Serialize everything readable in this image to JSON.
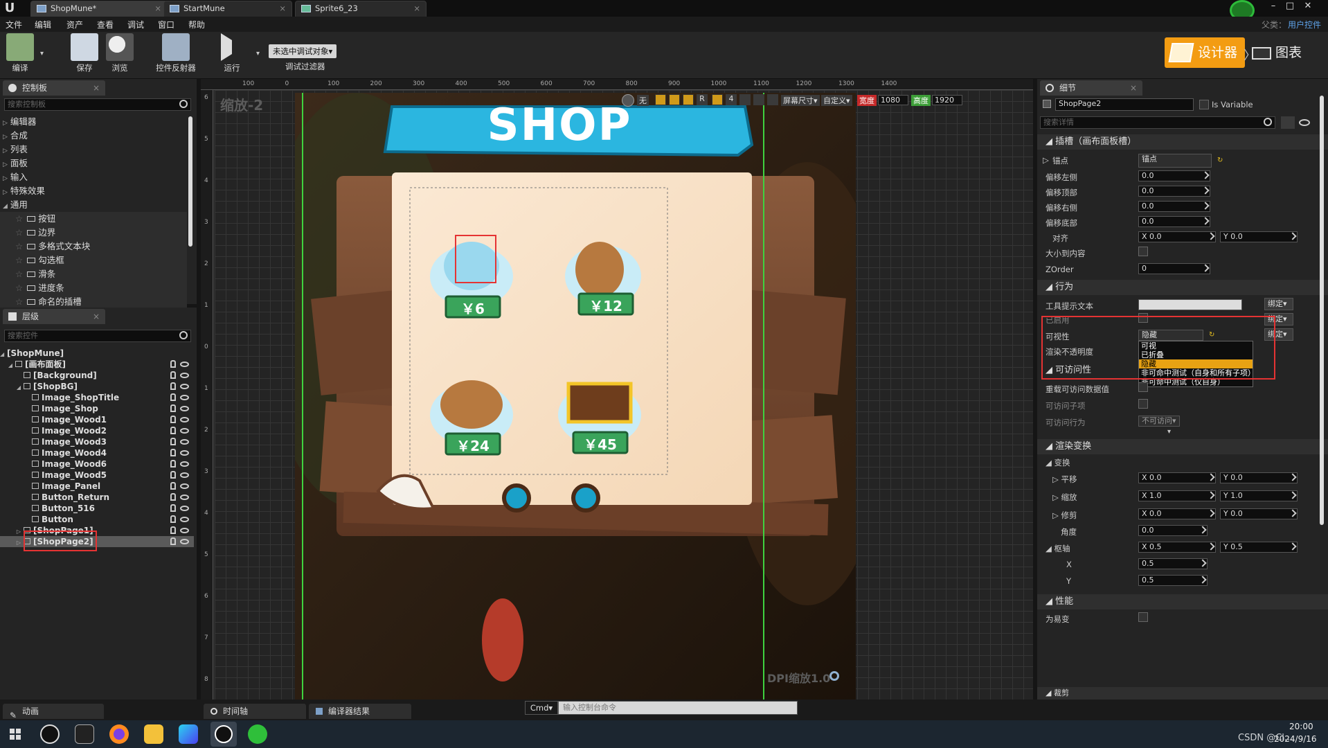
{
  "tabs": [
    {
      "label": "ShopMune*",
      "active": true
    },
    {
      "label": "StartMune",
      "active": false
    },
    {
      "label": "Sprite6_23",
      "active": false
    }
  ],
  "menu": [
    "文件",
    "编辑",
    "资产",
    "查看",
    "调试",
    "窗口",
    "帮助"
  ],
  "context": {
    "label": "父类：",
    "value": "用户控件"
  },
  "toolbar": {
    "compile": "编译",
    "save": "保存",
    "browse": "浏览",
    "reflector": "控件反射器",
    "run": "运行",
    "debug_select": "未选中调试对象▾",
    "debug_filter": "调试过滤器",
    "designer": "设计器",
    "graph": "图表"
  },
  "palette": {
    "title": "控制板",
    "search_placeholder": "搜索控制板",
    "categories": [
      "编辑器",
      "合成",
      "列表",
      "面板",
      "输入",
      "特殊效果",
      "通用"
    ],
    "items": [
      "按钮",
      "边界",
      "多格式文本块",
      "勾选框",
      "滑条",
      "进度条",
      "命名的插槽"
    ]
  },
  "hierarchy": {
    "title": "层级",
    "search_placeholder": "搜索控件",
    "rows": [
      {
        "label": "[ShopMune]",
        "indent": 0
      },
      {
        "label": "[画布面板]",
        "indent": 1
      },
      {
        "label": "[Background]",
        "indent": 2
      },
      {
        "label": "[ShopBG]",
        "indent": 2
      },
      {
        "label": "Image_ShopTitle",
        "indent": 3
      },
      {
        "label": "Image_Shop",
        "indent": 3
      },
      {
        "label": "Image_Wood1",
        "indent": 3
      },
      {
        "label": "Image_Wood2",
        "indent": 3
      },
      {
        "label": "Image_Wood3",
        "indent": 3
      },
      {
        "label": "Image_Wood4",
        "indent": 3
      },
      {
        "label": "Image_Wood6",
        "indent": 3
      },
      {
        "label": "Image_Wood5",
        "indent": 3
      },
      {
        "label": "Image_Panel",
        "indent": 3
      },
      {
        "label": "Button_Return",
        "indent": 3
      },
      {
        "label": "Button_516",
        "indent": 3
      },
      {
        "label": "Button",
        "indent": 3
      },
      {
        "label": "[ShopPage1]",
        "indent": 2
      },
      {
        "label": "[ShopPage2]",
        "indent": 2
      }
    ]
  },
  "canvas": {
    "zoom": "缩放-2",
    "dpi": "DPI缩放1.0",
    "ruler_top": [
      "100",
      "0",
      "100",
      "200",
      "300",
      "400",
      "500",
      "600",
      "700",
      "800",
      "900",
      "1000",
      "1100",
      "1200",
      "1300",
      "1400"
    ],
    "ruler_left": [
      "6",
      "5",
      "4",
      "3",
      "2",
      "1",
      "0",
      "1",
      "2",
      "3",
      "4",
      "5",
      "6",
      "7",
      "8"
    ],
    "topbar": {
      "none": "无",
      "screen": "屏幕尺寸▾",
      "custom": "自定义▾",
      "width_label": "宽度",
      "width": "1080",
      "height_label": "高度",
      "height": "1920",
      "r": "R",
      "four": "4"
    },
    "shop_title": "SHOP",
    "prices": [
      "￥6",
      "￥12",
      "￥24",
      "￥45"
    ]
  },
  "details": {
    "title": "细节",
    "name": "ShopPage2",
    "is_variable": "Is Variable",
    "search_placeholder": "搜索详情",
    "slot_section": "插槽（画布面板槽）",
    "anchor_label": "锚点",
    "anchor_value": "锚点",
    "offset_left": "偏移左侧",
    "offset_left_v": "0.0",
    "offset_top": "偏移顶部",
    "offset_top_v": "0.0",
    "offset_right": "偏移右侧",
    "offset_right_v": "0.0",
    "offset_bottom": "偏移底部",
    "offset_bottom_v": "0.0",
    "align": "对齐",
    "align_x": "X  0.0",
    "align_y": "Y  0.0",
    "size_to_content": "大小到内容",
    "zorder": "ZOrder",
    "zorder_v": "0",
    "behavior": "行为",
    "tooltip": "工具提示文本",
    "enabled": "已启用",
    "visibility": "可视性",
    "visibility_value": "隐藏",
    "render_opacity": "渲染不透明度",
    "bind": "绑定▾",
    "visibility_options": [
      "可视",
      "已折叠",
      "隐藏",
      "非可命中测试（自身和所有子项）",
      "非可命中测试（仅自身）"
    ],
    "accessibility": "可访问性",
    "override_access": "重载可访问数据值",
    "access_children": "可访问子项",
    "access_behavior": "可访问行为",
    "access_behavior_v": "不可访问▾",
    "render_transform": "渲染变换",
    "transform": "变换",
    "translation": "平移",
    "t_x": "X  0.0",
    "t_y": "Y  0.0",
    "scale": "缩放",
    "s_x": "X  1.0",
    "s_y": "Y  1.0",
    "shear": "修剪",
    "sh_x": "X  0.0",
    "sh_y": "Y  0.0",
    "angle": "角度",
    "angle_v": "0.0",
    "pivot": "枢轴",
    "p_x": "X  0.5",
    "p_y": "Y  0.5",
    "pivot_x_label": "X",
    "pivot_x": "0.5",
    "pivot_y_label": "Y",
    "pivot_y": "0.5",
    "performance": "性能",
    "volatile": "为易变",
    "clipping": "裁剪"
  },
  "bottom": {
    "anim": "动画",
    "timeline": "时间轴",
    "compiler": "编译器结果",
    "cmd": "Cmd▾",
    "cmd_placeholder": "输入控制台命令"
  },
  "taskbar": {
    "time": "20:00",
    "date": "2024/9/16",
    "watermark": "CSDN @Cl..."
  }
}
